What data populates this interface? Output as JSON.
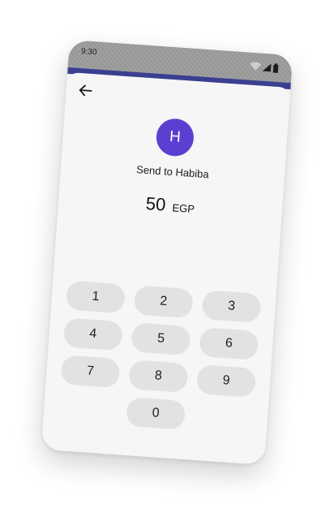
{
  "status_bar": {
    "time": "9:30",
    "icons": [
      "wifi-icon",
      "signal-icon",
      "battery-icon"
    ]
  },
  "header": {
    "back_icon": "back-arrow-icon"
  },
  "recipient": {
    "initial": "H",
    "send_label": "Send to Habiba"
  },
  "amount": {
    "value": "50",
    "currency": "EGP"
  },
  "keypad": {
    "keys": [
      "1",
      "2",
      "3",
      "4",
      "5",
      "6",
      "7",
      "8",
      "9",
      "0"
    ]
  },
  "colors": {
    "avatar": "#5b3fd0",
    "accent_strip": "#3b3f8f",
    "key_background": "#e2e2e2",
    "screen_background": "#f6f6f6"
  }
}
